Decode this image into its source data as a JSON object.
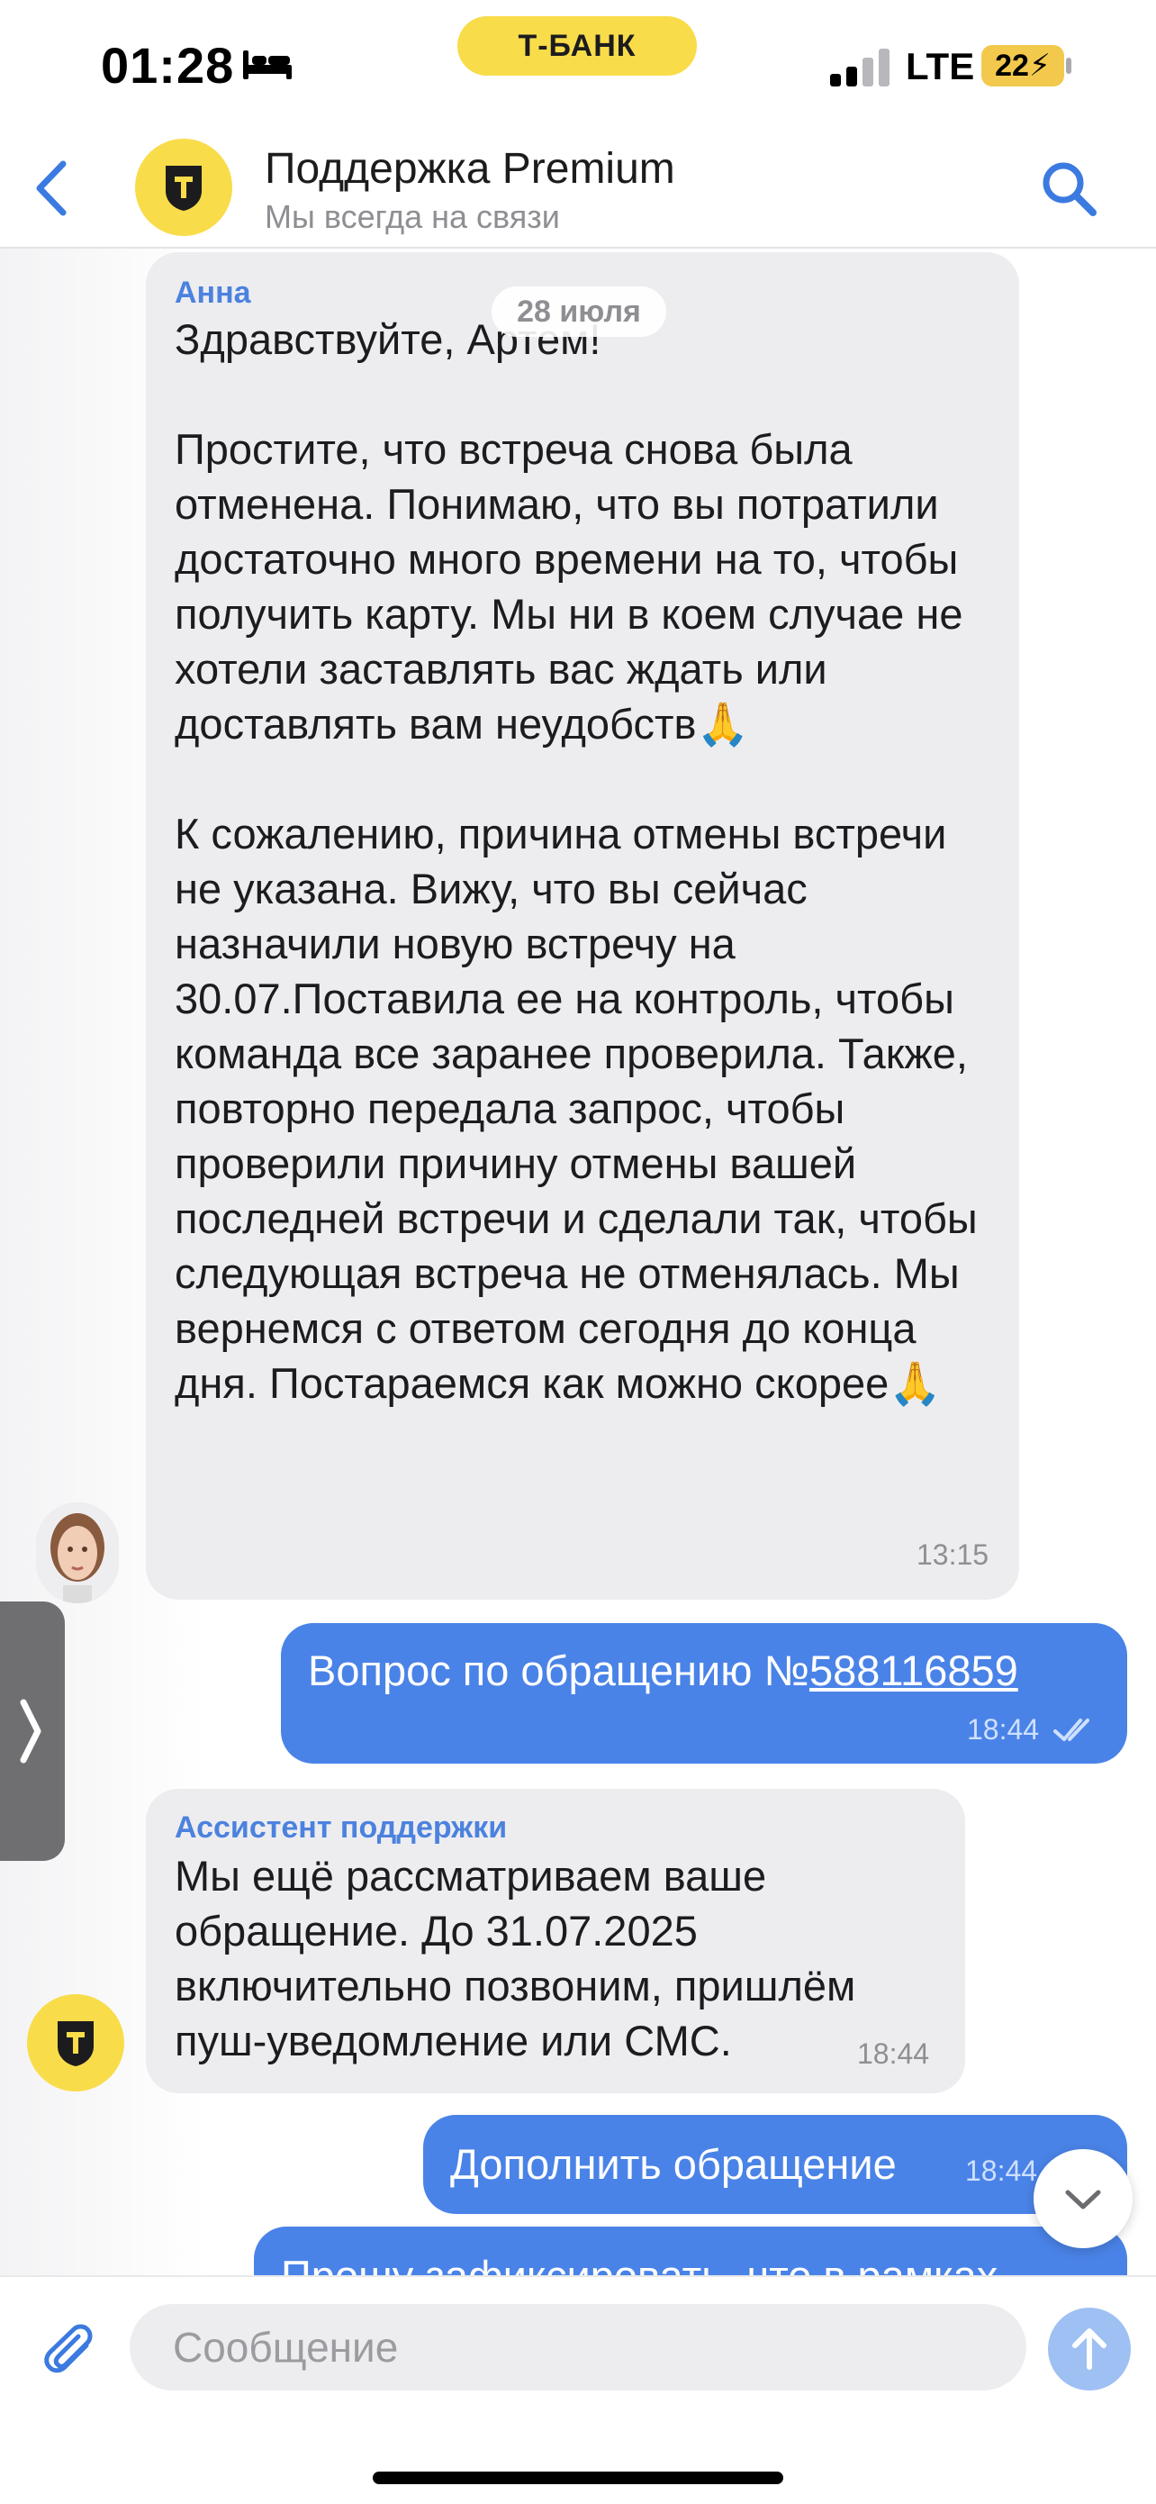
{
  "status_bar": {
    "time": "01:28",
    "carrier_badge": "Т-БАНК",
    "network": "LTE",
    "battery": "22"
  },
  "header": {
    "title": "Поддержка Premium",
    "subtitle": "Мы всегда на связи",
    "avatar_letter": "Т",
    "icons": [
      "back-chevron-icon",
      "search-icon"
    ]
  },
  "chat": {
    "date_separator": "28 июля",
    "messages": [
      {
        "sender": "Анна",
        "direction": "in",
        "text": "Здравствуйте, Артем!\n\nПростите, что встреча снова была отменена. Понимаю, что вы потратили достаточно много времени на то, чтобы получить карту. Мы ни в коем случае не хотели заставлять вас ждать или доставлять вам неудобств🙏\n\nК сожалению, причина отмены встречи не указана. Вижу, что вы сейчас назначили новую встречу на 30.07.Поставила ее на контроль, чтобы команда все заранее проверила. Также, повторно передала запрос, чтобы проверили причину отмены вашей последней встречи и сделали так, чтобы следующая встреча не отменялась. Мы вернемся с ответом сегодня до конца дня. Постараемся как можно скорее🙏",
        "time": "13:15"
      },
      {
        "direction": "out",
        "text_prefix": "Вопрос по обращению №",
        "link_text": "588116859",
        "time": "18:44",
        "status": "read"
      },
      {
        "sender": "Ассистент поддержки",
        "direction": "in",
        "text": "Мы ещё рассматриваем ваше обращение. До 31.07.2025 включительно позвоним, пришлём пуш-уведомление или СМС.",
        "time": "18:44"
      },
      {
        "direction": "out",
        "text": "Дополнить обращение",
        "time": "18:44"
      },
      {
        "direction": "out",
        "text": "Прошу зафиксировать, что в рамках"
      }
    ]
  },
  "composer": {
    "placeholder": "Сообщение"
  },
  "colors": {
    "brand_yellow": "#f9dc4a",
    "outgoing_bubble": "#4a83e7",
    "incoming_bubble": "#ededf0",
    "accent_blue": "#4c82de"
  }
}
